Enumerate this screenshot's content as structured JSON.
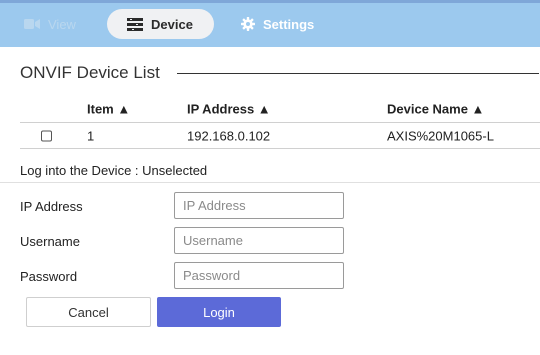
{
  "nav": {
    "tabs": [
      {
        "label": "View",
        "icon": "video-camera-icon",
        "state": "disabled"
      },
      {
        "label": "Device",
        "icon": "device-list-icon",
        "state": "active"
      },
      {
        "label": "Settings",
        "icon": "gear-icon",
        "state": "normal"
      }
    ]
  },
  "section": {
    "title": "ONVIF Device List"
  },
  "table": {
    "headers": [
      "Item ▲",
      "IP Address ▲",
      "Device Name ▲"
    ],
    "rows": [
      {
        "checked": false,
        "item": "1",
        "ip": "192.168.0.102",
        "name": "AXIS%20M1065-L"
      }
    ]
  },
  "login": {
    "status": "Log into the Device : Unselected",
    "fields": [
      {
        "label": "IP Address",
        "value": "",
        "placeholder": "IP Address"
      },
      {
        "label": "Username",
        "value": "",
        "placeholder": "Username"
      },
      {
        "label": "Password",
        "value": "",
        "placeholder": "Password"
      }
    ],
    "cancel_label": "Cancel",
    "login_label": "Login"
  },
  "colors": {
    "nav_bg": "#9cc9ee",
    "active_tab_bg": "#f0f1f3",
    "primary_button": "#5c6ad8"
  }
}
